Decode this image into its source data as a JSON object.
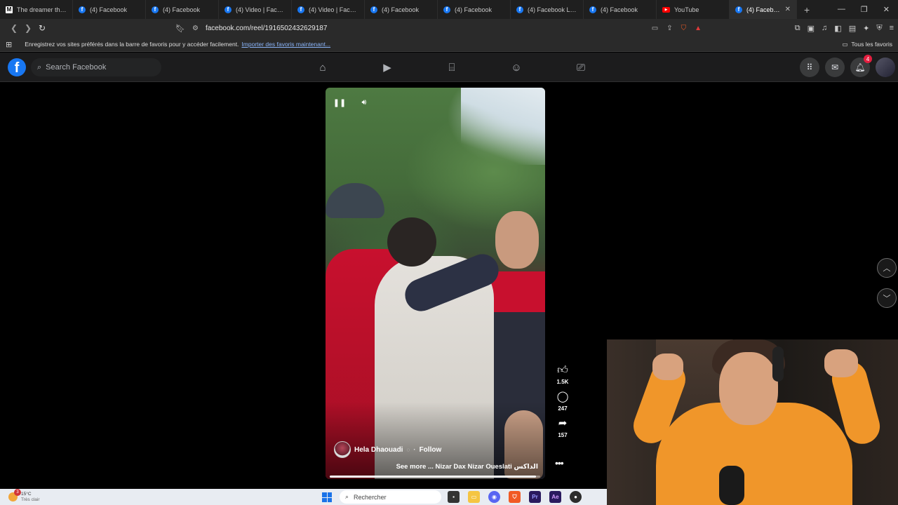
{
  "browser": {
    "tabs": [
      {
        "title": "The dreamer that T",
        "icon": "medium-icon"
      },
      {
        "title": "(4) Facebook",
        "icon": "facebook-icon"
      },
      {
        "title": "(4) Facebook",
        "icon": "facebook-icon"
      },
      {
        "title": "(4) Video | Facebook",
        "icon": "facebook-icon"
      },
      {
        "title": "(4) Video | Facebook",
        "icon": "facebook-icon"
      },
      {
        "title": "(4) Facebook",
        "icon": "facebook-icon"
      },
      {
        "title": "(4) Facebook",
        "icon": "facebook-icon"
      },
      {
        "title": "(4) Facebook Live |",
        "icon": "facebook-icon"
      },
      {
        "title": "(4) Facebook",
        "icon": "facebook-icon"
      },
      {
        "title": "YouTube",
        "icon": "youtube-icon"
      },
      {
        "title": "(4) Facebook",
        "icon": "facebook-icon",
        "active": true
      }
    ],
    "url": "facebook.com/reel/1916502432629187",
    "bookmarks_bar": {
      "message": "Enregistrez vos sites préférés dans la barre de favoris pour y accéder facilement.",
      "import_link": "Importer des favoris maintenant...",
      "all_favorites": "Tous les favoris"
    }
  },
  "facebook": {
    "search_placeholder": "Search Facebook",
    "notification_count": "4",
    "nav_icons": [
      "home-icon",
      "video-icon",
      "marketplace-icon",
      "groups-icon",
      "gaming-icon"
    ]
  },
  "reel": {
    "author": "Hela Dhaouadi",
    "follow_label": "Follow",
    "separator": "·",
    "caption": "See more ... Nizar Dax Nizar Oueslati الداكس",
    "progress": 0.98,
    "likes": "1.5K",
    "comments": "247",
    "shares": "157"
  },
  "taskbar": {
    "temperature": "15°C",
    "condition": "Très clair",
    "weather_badge": "3",
    "search_placeholder": "Rechercher"
  }
}
